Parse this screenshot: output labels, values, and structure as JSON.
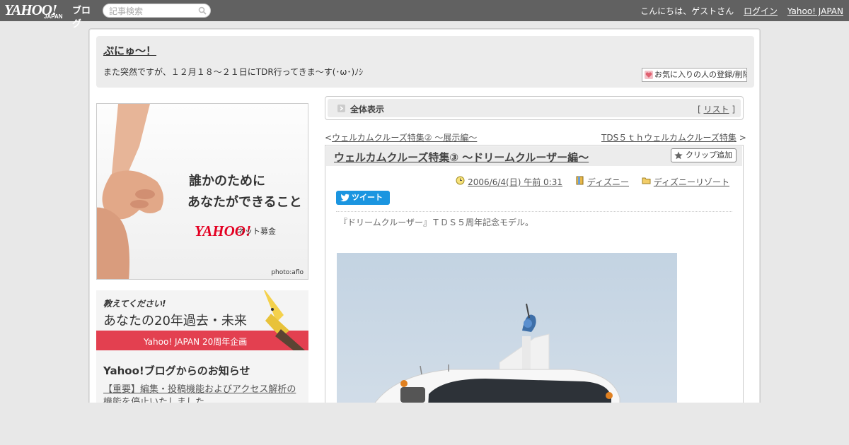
{
  "topbar": {
    "logo_text": "YAHOO!",
    "logo_sub": "JAPAN",
    "service_name": "ブログ",
    "search_placeholder": "記事検索",
    "greeting": "こんにちは、ゲストさん",
    "login_label": "ログイン",
    "yahoo_japan_label": "Yahoo! JAPAN"
  },
  "blog": {
    "title": "ぷにゅ～！",
    "description": "また突然ですが、１２月１８～２１日にTDR行ってきま～す(･ω･)ﾉｼ",
    "fav_button_label": "お気に入りの人の登録/削除"
  },
  "sidebar": {
    "ad": {
      "line1": "誰かのために",
      "line2": "あなたができること",
      "brand": "YAHOO!",
      "brand_sub": "ネット募金",
      "credit": "photo:aflo"
    },
    "promo": {
      "line1": "教えてください!",
      "line2": "あなたの20年過去・未来",
      "line3": "Yahoo! JAPAN 20周年企画"
    },
    "notice": {
      "title": "Yahoo!ブログからのお知らせ",
      "link_text": "【重要】編集・投稿機能およびアクセス解析の機能を停止いたしました"
    }
  },
  "main": {
    "view_label": "全体表示",
    "list_label": "リスト",
    "prev_link": "ウェルカムクルーズ特集② ～展示編～",
    "next_link": "TDS５ｔｈウェルカムクルーズ特集",
    "entry": {
      "title": "ウェルカムクルーズ特集③ ～ドリームクルーザー編～",
      "clip_label": "クリップ追加",
      "date": "2006/6/4(日) 午前 0:31",
      "category": "ディズニー",
      "folder": "ディズニーリゾート",
      "tweet_label": "ツイート",
      "body": "『ドリームクルーザー』ＴＤＳ５周年記念モデル。"
    }
  },
  "colors": {
    "topbar": "#616161",
    "tweet_blue": "#1b95e0",
    "promo_red": "#e34050",
    "yahoo_red": "#e40022"
  }
}
